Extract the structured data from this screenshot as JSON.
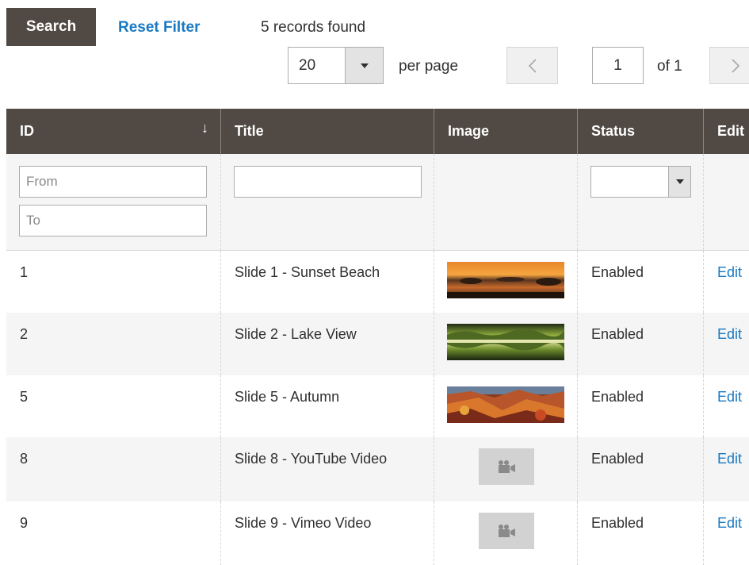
{
  "toolbar": {
    "search_label": "Search",
    "reset_label": "Reset Filter",
    "records_text": "5 records found",
    "per_page_value": "20",
    "per_page_label": "per page",
    "page_current": "1",
    "page_total_text": "of 1",
    "prev_icon": "chevron-left-icon",
    "next_icon": "chevron-right-icon"
  },
  "grid": {
    "columns": [
      "ID",
      "Title",
      "Image",
      "Status",
      "Edit"
    ],
    "sort_indicator": "↓",
    "filters": {
      "id_from_placeholder": "From",
      "id_to_placeholder": "To",
      "title_value": "",
      "status_value": ""
    },
    "rows": [
      {
        "id": "1",
        "title": "Slide 1 - Sunset Beach",
        "image": "sunset-thumbnail",
        "status": "Enabled",
        "action": "Edit"
      },
      {
        "id": "2",
        "title": "Slide 2 - Lake View",
        "image": "lake-thumbnail",
        "status": "Enabled",
        "action": "Edit"
      },
      {
        "id": "5",
        "title": "Slide 5 - Autumn",
        "image": "autumn-thumbnail",
        "status": "Enabled",
        "action": "Edit"
      },
      {
        "id": "8",
        "title": "Slide 8 - YouTube Video",
        "image": "video-camera-icon",
        "status": "Enabled",
        "action": "Edit"
      },
      {
        "id": "9",
        "title": "Slide 9 - Vimeo Video",
        "image": "video-camera-icon",
        "status": "Enabled",
        "action": "Edit"
      }
    ]
  },
  "colors": {
    "header_bg": "#514943",
    "link": "#1979c3",
    "filter_bg": "#f5f5f5"
  }
}
